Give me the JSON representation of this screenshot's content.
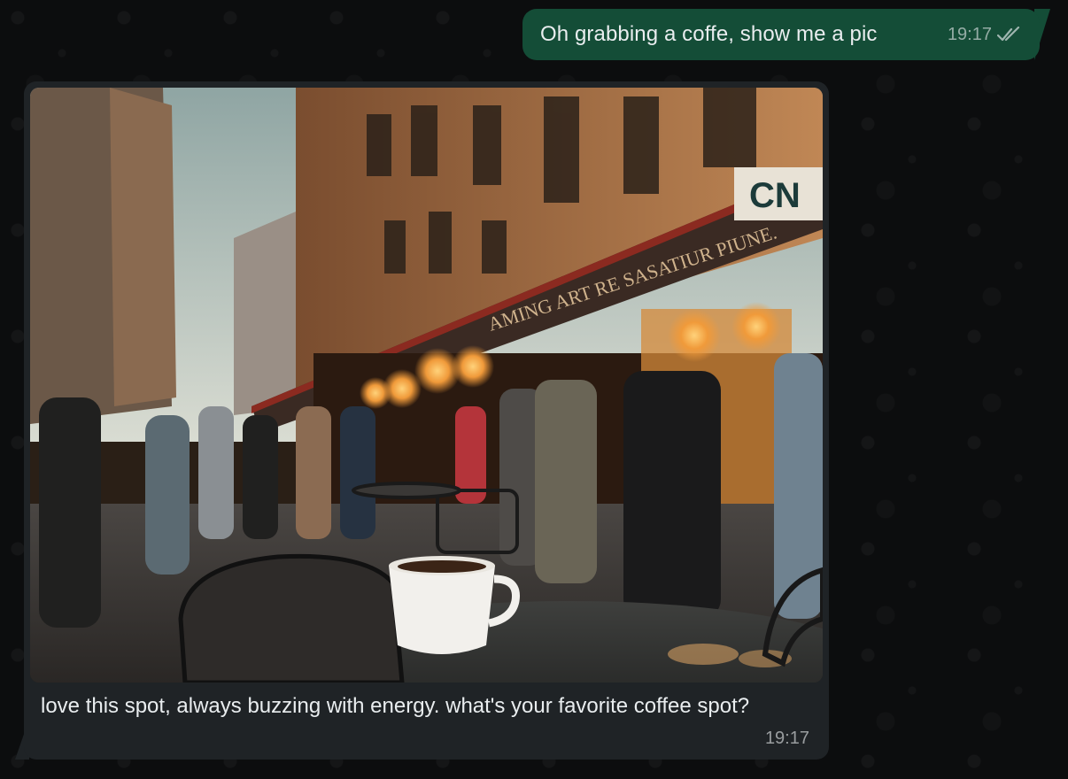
{
  "messages": [
    {
      "direction": "outgoing",
      "text": "Oh grabbing a coffe, show me a pic",
      "time": "19:17",
      "status_icon": "double-check-icon"
    },
    {
      "direction": "incoming",
      "has_image": true,
      "text": "love this spot, always buzzing with energy. what's your favorite coffee spot?",
      "time": "19:17"
    }
  ],
  "photo": {
    "awning_text": "AMING ART RE SASATIUR PIUNE.",
    "corner_sign_text": "CN"
  },
  "colors": {
    "outgoing_bubble": "#144d37",
    "incoming_bubble": "#1f2326",
    "background": "#0c0d0e",
    "text": "#e9edef"
  }
}
